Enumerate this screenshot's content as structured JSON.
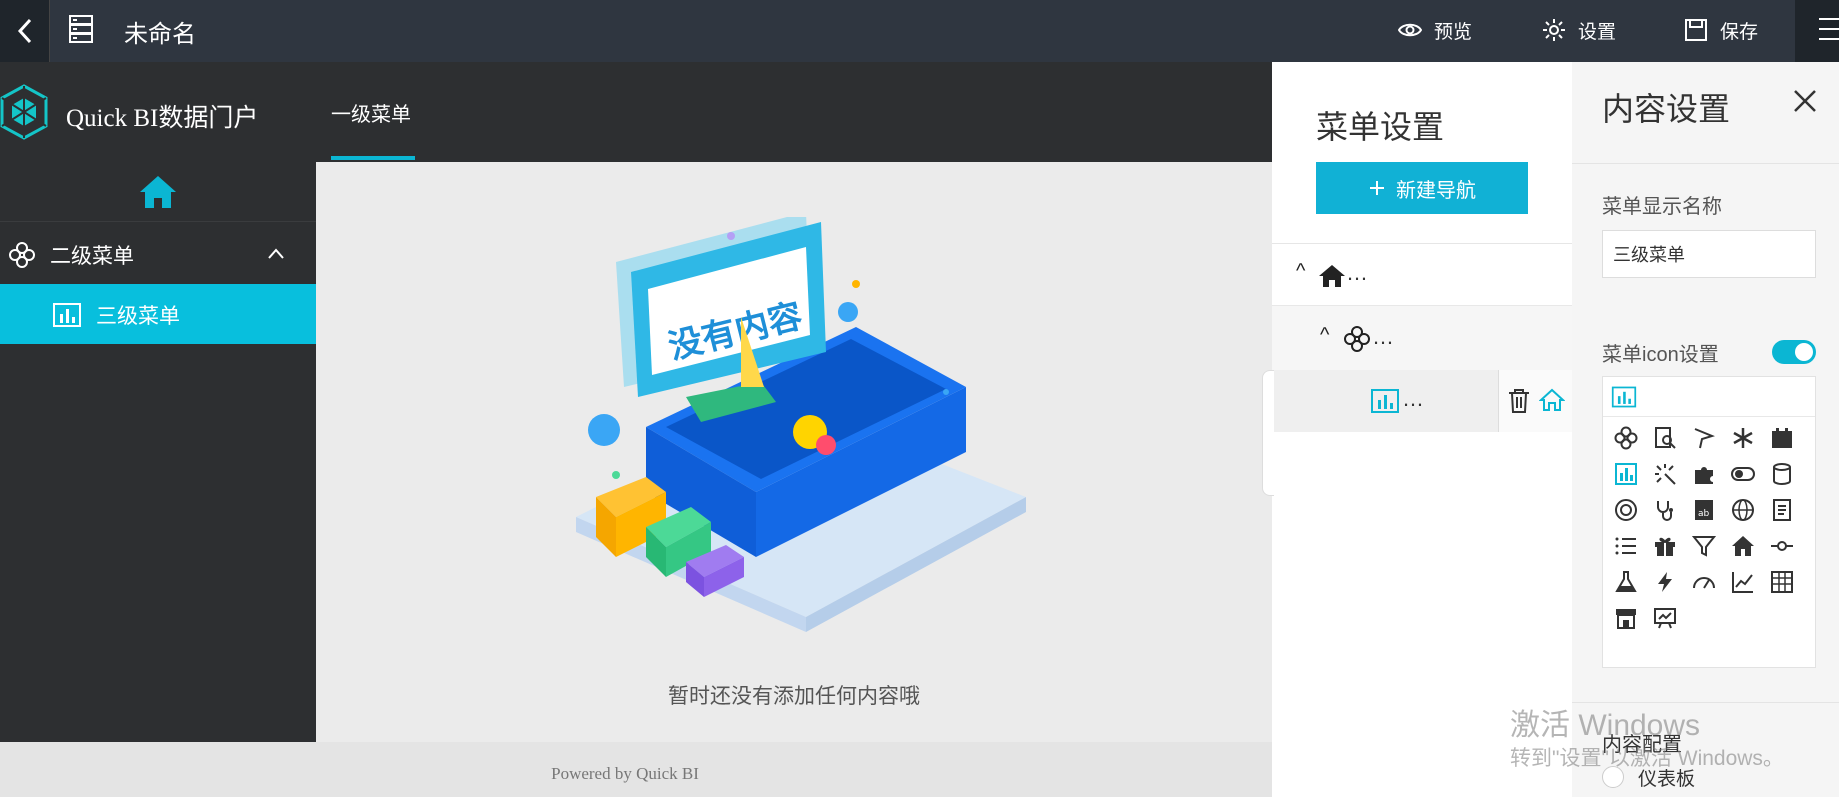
{
  "toolbar": {
    "back_icon": "chevron-left-icon",
    "doc_icon": "server-icon",
    "title": "未命名",
    "preview_label": "预览",
    "settings_label": "设置",
    "save_label": "保存"
  },
  "portal": {
    "brand": "Quick BI数据门户",
    "tabs": [
      {
        "label": "一级菜单",
        "active": true
      }
    ]
  },
  "sidebar": {
    "home_icon": "home-icon",
    "items": [
      {
        "label": "二级菜单",
        "icon": "clover-icon",
        "expanded": true
      },
      {
        "label": "三级菜单",
        "icon": "bar-chart-icon",
        "active": true
      }
    ]
  },
  "main": {
    "illustration_text": "没有内容",
    "empty_text": "暂时还没有添加任何内容哦"
  },
  "footer": {
    "powered_by": "Powered by Quick BI"
  },
  "menu_settings": {
    "title": "菜单设置",
    "new_nav_label": "新建导航",
    "new_nav_icon": "plus-icon",
    "tree": [
      {
        "level": 1,
        "icon": "home-icon",
        "label": "…",
        "caret": "^"
      },
      {
        "level": 2,
        "icon": "clover-icon",
        "label": "…",
        "caret": "^"
      },
      {
        "level": 3,
        "icon": "bar-chart-icon",
        "label": "…",
        "actions": [
          "trash-icon",
          "home-outline-icon"
        ]
      }
    ]
  },
  "content_settings": {
    "title": "内容设置",
    "display_name_label": "菜单显示名称",
    "display_name_value": "三级菜单",
    "icon_setting_label": "菜单icon设置",
    "icon_toggle_on": true,
    "selected_icon": "bar-chart-icon",
    "icon_options": [
      "clover-icon",
      "search-doc-icon",
      "flag-icon",
      "asterisk-icon",
      "calendar-icon",
      "bar-chart-icon",
      "click-icon",
      "puzzle-icon",
      "toggle-icon",
      "database-icon",
      "speedometer-icon",
      "stethoscope-icon",
      "ab-icon",
      "globe-icon",
      "document-icon",
      "list-icon",
      "gift-icon",
      "filter-icon",
      "home-icon",
      "commit-icon",
      "flask-icon",
      "bolt-icon",
      "gauge-icon",
      "line-chart-icon",
      "table-icon",
      "store-icon",
      "presentation-icon"
    ],
    "content_config_label": "内容配置",
    "radio_label": "仪表板"
  },
  "watermark": {
    "line1": "激活 Windows",
    "line2": "转到\"设置\"以激活 Windows。"
  },
  "colors": {
    "accent": "#08bfdd",
    "button": "#11b1d5",
    "dark": "#2d2f31",
    "toolbar": "#2f3640"
  }
}
